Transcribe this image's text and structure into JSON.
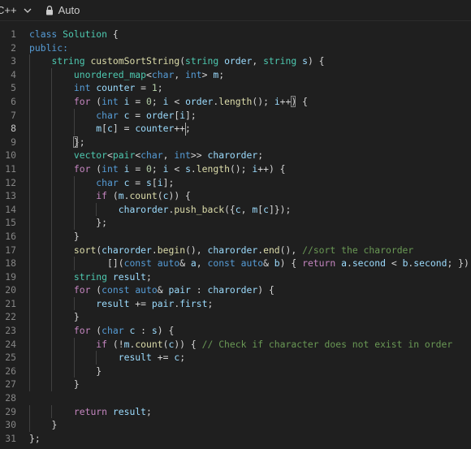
{
  "toolbar": {
    "language": "C++",
    "mode": "Auto"
  },
  "editor": {
    "active_line": 8,
    "lines": [
      {
        "n": "1",
        "indent": 0,
        "tokens": [
          {
            "t": "class ",
            "c": "kw"
          },
          {
            "t": "Solution",
            "c": "ty"
          },
          {
            "t": " {",
            "c": "pl"
          }
        ]
      },
      {
        "n": "2",
        "indent": 0,
        "tokens": [
          {
            "t": "public:",
            "c": "kw"
          }
        ]
      },
      {
        "n": "3",
        "indent": 1,
        "tokens": [
          {
            "t": "string ",
            "c": "ty"
          },
          {
            "t": "customSortString",
            "c": "fn"
          },
          {
            "t": "(",
            "c": "pl"
          },
          {
            "t": "string ",
            "c": "ty"
          },
          {
            "t": "order",
            "c": "var"
          },
          {
            "t": ", ",
            "c": "pl"
          },
          {
            "t": "string ",
            "c": "ty"
          },
          {
            "t": "s",
            "c": "var"
          },
          {
            "t": ") {",
            "c": "pl"
          }
        ]
      },
      {
        "n": "4",
        "indent": 2,
        "tokens": [
          {
            "t": "unordered_map",
            "c": "ty"
          },
          {
            "t": "<",
            "c": "pl"
          },
          {
            "t": "char",
            "c": "kw"
          },
          {
            "t": ", ",
            "c": "pl"
          },
          {
            "t": "int",
            "c": "kw"
          },
          {
            "t": "> ",
            "c": "pl"
          },
          {
            "t": "m",
            "c": "var"
          },
          {
            "t": ";",
            "c": "pl"
          }
        ]
      },
      {
        "n": "5",
        "indent": 2,
        "tokens": [
          {
            "t": "int ",
            "c": "kw"
          },
          {
            "t": "counter",
            "c": "var"
          },
          {
            "t": " = ",
            "c": "pl"
          },
          {
            "t": "1",
            "c": "num"
          },
          {
            "t": ";",
            "c": "pl"
          }
        ]
      },
      {
        "n": "6",
        "indent": 2,
        "tokens": [
          {
            "t": "for",
            "c": "ctl"
          },
          {
            "t": " (",
            "c": "pl"
          },
          {
            "t": "int ",
            "c": "kw"
          },
          {
            "t": "i",
            "c": "var"
          },
          {
            "t": " = ",
            "c": "pl"
          },
          {
            "t": "0",
            "c": "num"
          },
          {
            "t": "; ",
            "c": "pl"
          },
          {
            "t": "i",
            "c": "var"
          },
          {
            "t": " < ",
            "c": "pl"
          },
          {
            "t": "order",
            "c": "var"
          },
          {
            "t": ".",
            "c": "pl"
          },
          {
            "t": "length",
            "c": "fn"
          },
          {
            "t": "(); ",
            "c": "pl"
          },
          {
            "t": "i",
            "c": "var"
          },
          {
            "t": "++) {",
            "c": "pl"
          }
        ]
      },
      {
        "n": "7",
        "indent": 3,
        "tokens": [
          {
            "t": "char ",
            "c": "kw"
          },
          {
            "t": "c",
            "c": "var"
          },
          {
            "t": " = ",
            "c": "pl"
          },
          {
            "t": "order",
            "c": "var"
          },
          {
            "t": "[",
            "c": "pl"
          },
          {
            "t": "i",
            "c": "var"
          },
          {
            "t": "];",
            "c": "pl"
          }
        ]
      },
      {
        "n": "8",
        "indent": 3,
        "tokens": [
          {
            "t": "m",
            "c": "var"
          },
          {
            "t": "[",
            "c": "pl"
          },
          {
            "t": "c",
            "c": "var"
          },
          {
            "t": "] = ",
            "c": "pl"
          },
          {
            "t": "counter",
            "c": "var"
          },
          {
            "t": "++;",
            "c": "pl"
          }
        ]
      },
      {
        "n": "9",
        "indent": 2,
        "tokens": [
          {
            "t": "};",
            "c": "pl"
          }
        ]
      },
      {
        "n": "10",
        "indent": 2,
        "tokens": [
          {
            "t": "vector",
            "c": "ty"
          },
          {
            "t": "<",
            "c": "pl"
          },
          {
            "t": "pair",
            "c": "ty"
          },
          {
            "t": "<",
            "c": "pl"
          },
          {
            "t": "char",
            "c": "kw"
          },
          {
            "t": ", ",
            "c": "pl"
          },
          {
            "t": "int",
            "c": "kw"
          },
          {
            "t": ">> ",
            "c": "pl"
          },
          {
            "t": "charorder",
            "c": "var"
          },
          {
            "t": ";",
            "c": "pl"
          }
        ]
      },
      {
        "n": "11",
        "indent": 2,
        "tokens": [
          {
            "t": "for",
            "c": "ctl"
          },
          {
            "t": " (",
            "c": "pl"
          },
          {
            "t": "int ",
            "c": "kw"
          },
          {
            "t": "i",
            "c": "var"
          },
          {
            "t": " = ",
            "c": "pl"
          },
          {
            "t": "0",
            "c": "num"
          },
          {
            "t": "; ",
            "c": "pl"
          },
          {
            "t": "i",
            "c": "var"
          },
          {
            "t": " < ",
            "c": "pl"
          },
          {
            "t": "s",
            "c": "var"
          },
          {
            "t": ".",
            "c": "pl"
          },
          {
            "t": "length",
            "c": "fn"
          },
          {
            "t": "(); ",
            "c": "pl"
          },
          {
            "t": "i",
            "c": "var"
          },
          {
            "t": "++) {",
            "c": "pl"
          }
        ]
      },
      {
        "n": "12",
        "indent": 3,
        "tokens": [
          {
            "t": "char ",
            "c": "kw"
          },
          {
            "t": "c",
            "c": "var"
          },
          {
            "t": " = ",
            "c": "pl"
          },
          {
            "t": "s",
            "c": "var"
          },
          {
            "t": "[",
            "c": "pl"
          },
          {
            "t": "i",
            "c": "var"
          },
          {
            "t": "];",
            "c": "pl"
          }
        ]
      },
      {
        "n": "13",
        "indent": 3,
        "tokens": [
          {
            "t": "if",
            "c": "ctl"
          },
          {
            "t": " (",
            "c": "pl"
          },
          {
            "t": "m",
            "c": "var"
          },
          {
            "t": ".",
            "c": "pl"
          },
          {
            "t": "count",
            "c": "fn"
          },
          {
            "t": "(",
            "c": "pl"
          },
          {
            "t": "c",
            "c": "var"
          },
          {
            "t": ")) {",
            "c": "pl"
          }
        ]
      },
      {
        "n": "14",
        "indent": 4,
        "tokens": [
          {
            "t": "charorder",
            "c": "var"
          },
          {
            "t": ".",
            "c": "pl"
          },
          {
            "t": "push_back",
            "c": "fn"
          },
          {
            "t": "({",
            "c": "pl"
          },
          {
            "t": "c",
            "c": "var"
          },
          {
            "t": ", ",
            "c": "pl"
          },
          {
            "t": "m",
            "c": "var"
          },
          {
            "t": "[",
            "c": "pl"
          },
          {
            "t": "c",
            "c": "var"
          },
          {
            "t": "]});",
            "c": "pl"
          }
        ]
      },
      {
        "n": "15",
        "indent": 3,
        "tokens": [
          {
            "t": "};",
            "c": "pl"
          }
        ]
      },
      {
        "n": "16",
        "indent": 2,
        "tokens": [
          {
            "t": "}",
            "c": "pl"
          }
        ]
      },
      {
        "n": "17",
        "indent": 2,
        "tokens": [
          {
            "t": "sort",
            "c": "fn"
          },
          {
            "t": "(",
            "c": "pl"
          },
          {
            "t": "charorder",
            "c": "var"
          },
          {
            "t": ".",
            "c": "pl"
          },
          {
            "t": "begin",
            "c": "fn"
          },
          {
            "t": "(), ",
            "c": "pl"
          },
          {
            "t": "charorder",
            "c": "var"
          },
          {
            "t": ".",
            "c": "pl"
          },
          {
            "t": "end",
            "c": "fn"
          },
          {
            "t": "(), ",
            "c": "pl"
          },
          {
            "t": "//sort the charorder",
            "c": "cmt"
          }
        ]
      },
      {
        "n": "18",
        "indent": 3,
        "extra": "  ",
        "tokens": [
          {
            "t": "[](",
            "c": "pl"
          },
          {
            "t": "const ",
            "c": "kw"
          },
          {
            "t": "auto",
            "c": "kw"
          },
          {
            "t": "& ",
            "c": "pl"
          },
          {
            "t": "a",
            "c": "var"
          },
          {
            "t": ", ",
            "c": "pl"
          },
          {
            "t": "const ",
            "c": "kw"
          },
          {
            "t": "auto",
            "c": "kw"
          },
          {
            "t": "& ",
            "c": "pl"
          },
          {
            "t": "b",
            "c": "var"
          },
          {
            "t": ") { ",
            "c": "pl"
          },
          {
            "t": "return ",
            "c": "ctl"
          },
          {
            "t": "a",
            "c": "var"
          },
          {
            "t": ".",
            "c": "pl"
          },
          {
            "t": "second",
            "c": "var"
          },
          {
            "t": " < ",
            "c": "pl"
          },
          {
            "t": "b",
            "c": "var"
          },
          {
            "t": ".",
            "c": "pl"
          },
          {
            "t": "second",
            "c": "var"
          },
          {
            "t": "; });",
            "c": "pl"
          }
        ]
      },
      {
        "n": "19",
        "indent": 2,
        "tokens": [
          {
            "t": "string ",
            "c": "ty"
          },
          {
            "t": "result",
            "c": "var"
          },
          {
            "t": ";",
            "c": "pl"
          }
        ]
      },
      {
        "n": "20",
        "indent": 2,
        "tokens": [
          {
            "t": "for",
            "c": "ctl"
          },
          {
            "t": " (",
            "c": "pl"
          },
          {
            "t": "const ",
            "c": "kw"
          },
          {
            "t": "auto",
            "c": "kw"
          },
          {
            "t": "& ",
            "c": "pl"
          },
          {
            "t": "pair",
            "c": "var"
          },
          {
            "t": " : ",
            "c": "pl"
          },
          {
            "t": "charorder",
            "c": "var"
          },
          {
            "t": ") {",
            "c": "pl"
          }
        ]
      },
      {
        "n": "21",
        "indent": 3,
        "tokens": [
          {
            "t": "result",
            "c": "var"
          },
          {
            "t": " += ",
            "c": "pl"
          },
          {
            "t": "pair",
            "c": "var"
          },
          {
            "t": ".",
            "c": "pl"
          },
          {
            "t": "first",
            "c": "var"
          },
          {
            "t": ";",
            "c": "pl"
          }
        ]
      },
      {
        "n": "22",
        "indent": 2,
        "tokens": [
          {
            "t": "}",
            "c": "pl"
          }
        ]
      },
      {
        "n": "23",
        "indent": 2,
        "tokens": [
          {
            "t": "for",
            "c": "ctl"
          },
          {
            "t": " (",
            "c": "pl"
          },
          {
            "t": "char ",
            "c": "kw"
          },
          {
            "t": "c",
            "c": "var"
          },
          {
            "t": " : ",
            "c": "pl"
          },
          {
            "t": "s",
            "c": "var"
          },
          {
            "t": ") {",
            "c": "pl"
          }
        ]
      },
      {
        "n": "24",
        "indent": 3,
        "tokens": [
          {
            "t": "if",
            "c": "ctl"
          },
          {
            "t": " (!",
            "c": "pl"
          },
          {
            "t": "m",
            "c": "var"
          },
          {
            "t": ".",
            "c": "pl"
          },
          {
            "t": "count",
            "c": "fn"
          },
          {
            "t": "(",
            "c": "pl"
          },
          {
            "t": "c",
            "c": "var"
          },
          {
            "t": ")) { ",
            "c": "pl"
          },
          {
            "t": "// Check if character does not exist in order",
            "c": "cmt"
          }
        ]
      },
      {
        "n": "25",
        "indent": 4,
        "tokens": [
          {
            "t": "result",
            "c": "var"
          },
          {
            "t": " += ",
            "c": "pl"
          },
          {
            "t": "c",
            "c": "var"
          },
          {
            "t": ";",
            "c": "pl"
          }
        ]
      },
      {
        "n": "26",
        "indent": 3,
        "tokens": [
          {
            "t": "}",
            "c": "pl"
          }
        ]
      },
      {
        "n": "27",
        "indent": 2,
        "tokens": [
          {
            "t": "}",
            "c": "pl"
          }
        ]
      },
      {
        "n": "28",
        "indent": 0,
        "tokens": []
      },
      {
        "n": "29",
        "indent": 2,
        "tokens": [
          {
            "t": "return ",
            "c": "ctl"
          },
          {
            "t": "result",
            "c": "var"
          },
          {
            "t": ";",
            "c": "pl"
          }
        ]
      },
      {
        "n": "30",
        "indent": 1,
        "tokens": [
          {
            "t": "}",
            "c": "pl"
          }
        ]
      },
      {
        "n": "31",
        "indent": 0,
        "tokens": [
          {
            "t": "};",
            "c": "pl"
          }
        ]
      }
    ]
  }
}
